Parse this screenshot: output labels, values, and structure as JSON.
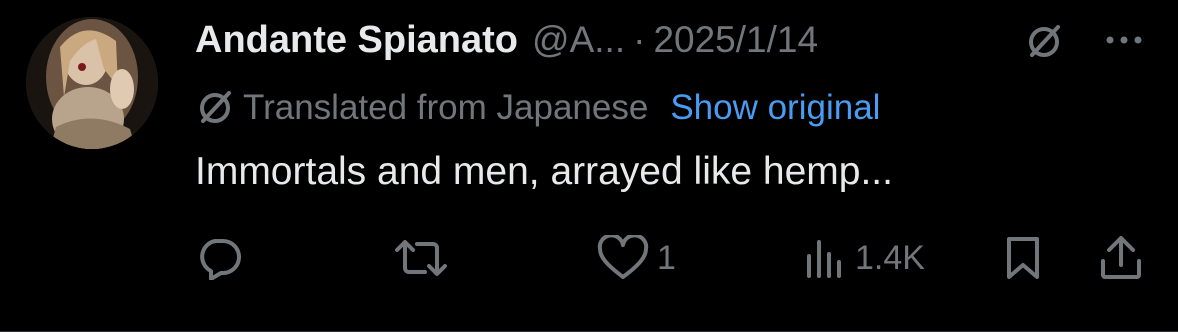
{
  "tweet": {
    "author_name": "Andante Spianato",
    "handle": "@A...",
    "separator": "·",
    "date": "2025/1/14",
    "translation_notice": "Translated from Japanese",
    "show_original_label": "Show original",
    "text": "Immortals and men, arrayed like hemp...",
    "stats": {
      "replies": "",
      "reposts": "",
      "likes": "1",
      "views": "1.4K"
    }
  },
  "icons": {
    "avatar": "avatar-photo",
    "grok": "grok-icon",
    "more": "more-icon",
    "translate": "translate-icon",
    "reply": "reply-icon",
    "repost": "repost-icon",
    "like": "heart-icon",
    "views": "views-icon",
    "bookmark": "bookmark-icon",
    "share": "share-icon"
  },
  "colors": {
    "background": "#000000",
    "primary_text": "#e7e9ea",
    "secondary_text": "#71767b",
    "link": "#4a9bf2",
    "divider": "#2f3336"
  }
}
